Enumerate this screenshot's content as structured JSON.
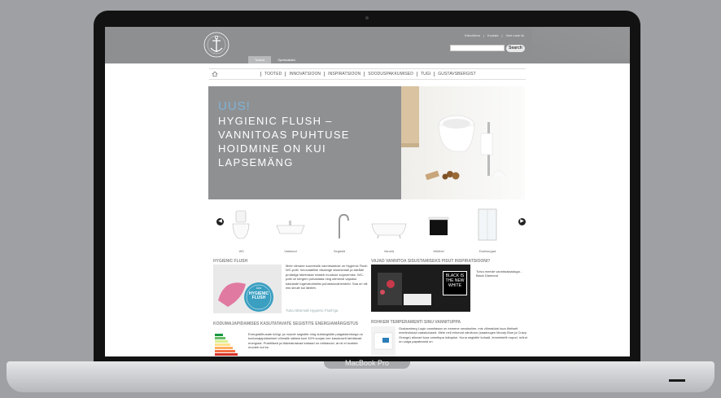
{
  "laptop": {
    "model_label": "MacBook Pro"
  },
  "site": {
    "logo_text": "GUSTAVSBERG",
    "top_links": [
      "Ettevõttest",
      "Kontakt",
      "Veel meie lik"
    ],
    "search": {
      "placeholder": "",
      "button_label": "Search"
    },
    "tabs": [
      {
        "label": "Tooted",
        "active": true
      },
      {
        "label": "Spetsialistid",
        "active": false
      }
    ],
    "nav": [
      "TOOTED",
      "INNOVATSIOON",
      "INSPIRATSIOON",
      "SOODUSPAKKUMISED",
      "TUGI",
      "GUSTAVSBERGIST"
    ]
  },
  "hero": {
    "kicker": "UUS!",
    "title": "HYGIENIC FLUSH –\nVANNITOAS PUHTUSE\nHOIDMINE ON KUI\nLAPSEMÄNG"
  },
  "carousel": {
    "products": [
      "WC",
      "Valamud",
      "Segistid",
      "Vannid",
      "Mööbel",
      "Dušinurgad"
    ]
  },
  "sections": {
    "hygienic": {
      "title": "HYGIENIC FLUSH",
      "body": "Meie viimane suurebulik vannitoastole on Hygienic Flush WC-potti. Innovaatiline disainige sisseseade ja sileåde prolistige täielmisse ridaleb muutuse kujunemise. WC-potti on kergem puhastada ning uitmendi vajadus kasutade tugevatoimelisi puhastusvahendeid. Saa on viit mis sinule kui läbiteh.",
      "link": "Tutvu lähemalt Hygienic Flush'ga",
      "badge_small": "Uus",
      "badge_big": "HYGIENIC FLUSH"
    },
    "inspiration": {
      "title": "VAJAD VANNITOA SISUSTAMISEKS PISUT INSPIRATSIOONI?",
      "tile_text": "BLACK IS THE NEW WHITE",
      "body": "Tutvu meede vannitoalaaduga - Black Diamond"
    },
    "energy": {
      "title": "KODUMAJAPIDAMISES KASUTATAVATE SEGISTITE ENERGIAMÄRGISTUS",
      "body": "Energiatõhusate köögi- ja muude segistite ning dušisegistite paigaldamisega on kodumajapidamistel võimalik säästa kuni 40% soojas vee kasutuselt tarbitavad energiast. Praktilised ja lääveatutavad kabaad on nähtavuid, at nii et tootiste mooteb kui ka"
    },
    "temperament": {
      "title": "ROHKEM TEMPERAMENTI SINU VANNITUPPA",
      "body": "Gustavsberg Logic vannitasan on esmene omalaoline, mis võimaldab luua tõeliselt meeleolukad vaaskutused. Meie neli erinevat värvitoon (saadvuges Moody Blue ja Crazy Orange) alluvad tuua vannitupa isikuplse. Kuna segistile kohadi, lemmistetli nupud, mõnd on calga papateaoid on"
    }
  }
}
